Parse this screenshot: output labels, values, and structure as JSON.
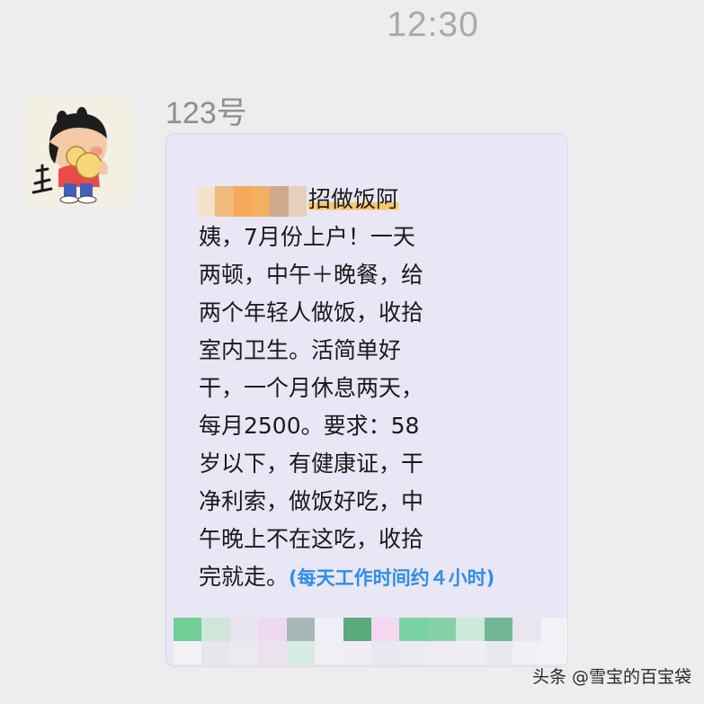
{
  "status": {
    "time": "12:30"
  },
  "sender": {
    "name": "123号",
    "avatar_icon": "cartoon-avatar-icon"
  },
  "message": {
    "lines": [
      "招做饭阿",
      "姨，7月份上户！一天",
      "两顿，中午＋晚餐，给",
      "两个年轻人做饭，收拾",
      "室内卫生。活简单好",
      "干，一个月休息两天，",
      "每月2500。要求：58",
      "岁以下，有健康证，干",
      "净利索，做饭好吃，中",
      "午晚上不在这吃，收拾",
      "完就走。"
    ],
    "note": "(每天工作时间约４小时)",
    "highlight_color": "#f7c96a",
    "note_color": "#2e8ee6",
    "bubble_color": "#e9e6f5"
  },
  "watermark": {
    "text": "头条 @雪宝的百宝袋"
  }
}
